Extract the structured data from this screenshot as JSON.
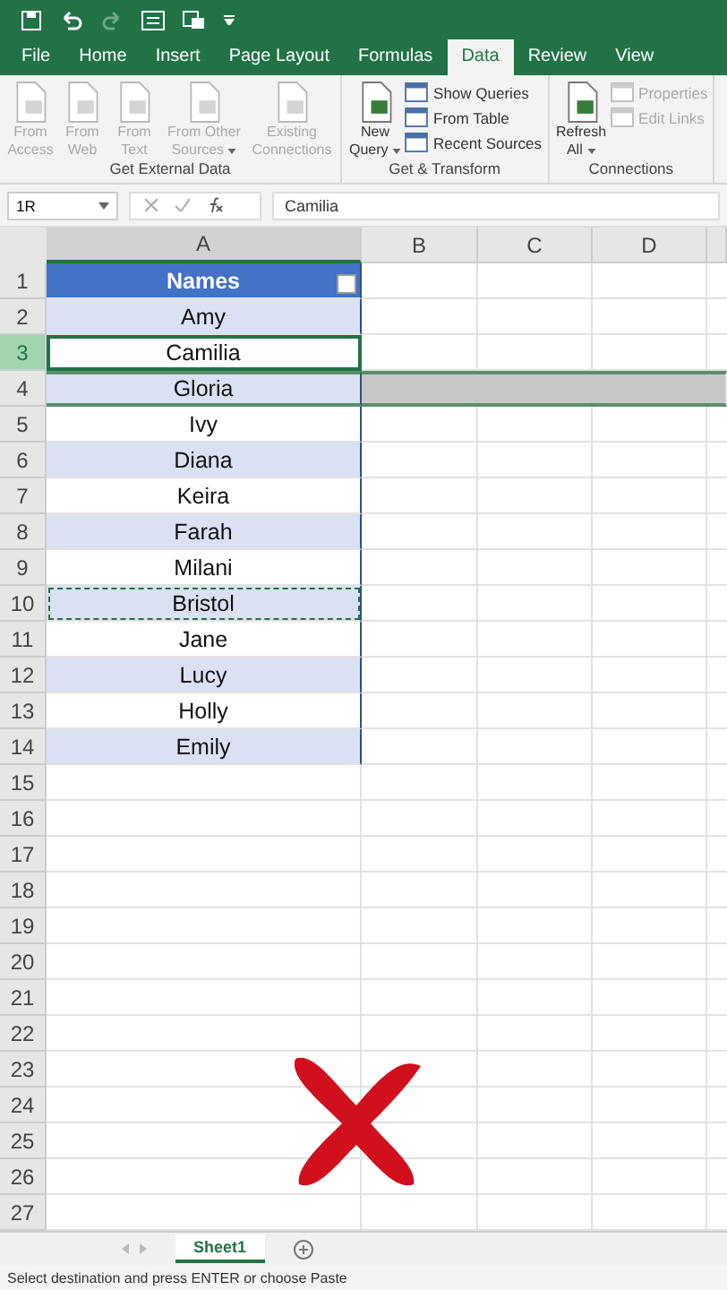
{
  "menu_tabs": [
    {
      "label": "File",
      "selected": false
    },
    {
      "label": "Home",
      "selected": false
    },
    {
      "label": "Insert",
      "selected": false
    },
    {
      "label": "Page Layout",
      "selected": false
    },
    {
      "label": "Formulas",
      "selected": false
    },
    {
      "label": "Data",
      "selected": true
    },
    {
      "label": "Review",
      "selected": false
    },
    {
      "label": "View",
      "selected": false
    }
  ],
  "ribbon_groups": [
    {
      "title": "Get External Data",
      "buttons": [
        {
          "kind": "large",
          "label": "From Access",
          "disabled": true,
          "dropdown": false
        },
        {
          "kind": "large",
          "label": "From Web",
          "disabled": true,
          "dropdown": false
        },
        {
          "kind": "large",
          "label": "From Text",
          "disabled": true,
          "dropdown": false
        },
        {
          "kind": "large",
          "label": "From Other Sources",
          "disabled": true,
          "dropdown": true
        },
        {
          "kind": "large",
          "label": "Existing Connections",
          "disabled": true,
          "dropdown": false
        }
      ]
    },
    {
      "title": "Get & Transform",
      "buttons": [
        {
          "kind": "large",
          "label": "New Query",
          "disabled": false,
          "dropdown": true
        },
        {
          "kind": "small",
          "label": "Show Queries",
          "disabled": false
        },
        {
          "kind": "small",
          "label": "From Table",
          "disabled": false
        },
        {
          "kind": "small",
          "label": "Recent Sources",
          "disabled": false
        }
      ]
    },
    {
      "title": "Connections",
      "buttons": [
        {
          "kind": "large",
          "label": "Refresh All",
          "disabled": false,
          "dropdown": true
        },
        {
          "kind": "small",
          "label": "Properties",
          "disabled": true
        },
        {
          "kind": "small",
          "label": "Edit Links",
          "disabled": true
        }
      ]
    }
  ],
  "name_box": "1R",
  "formula": "Camilia",
  "columns": [
    "A",
    "B",
    "C",
    "D"
  ],
  "header_cell": "Names",
  "rows": [
    {
      "name": "Amy",
      "selected": false,
      "copied": false,
      "drop_target": false
    },
    {
      "name": "Camilia",
      "selected": true,
      "copied": false,
      "drop_target": false
    },
    {
      "name": "Gloria",
      "selected": false,
      "copied": false,
      "drop_target": true
    },
    {
      "name": "Ivy",
      "selected": false,
      "copied": false,
      "drop_target": false
    },
    {
      "name": "Diana",
      "selected": false,
      "copied": false,
      "drop_target": false
    },
    {
      "name": "Keira",
      "selected": false,
      "copied": false,
      "drop_target": false
    },
    {
      "name": "Farah",
      "selected": false,
      "copied": false,
      "drop_target": false
    },
    {
      "name": "Milani",
      "selected": false,
      "copied": false,
      "drop_target": false
    },
    {
      "name": "Bristol",
      "selected": false,
      "copied": true,
      "drop_target": false
    },
    {
      "name": "Jane",
      "selected": false,
      "copied": false,
      "drop_target": false
    },
    {
      "name": "Lucy",
      "selected": false,
      "copied": false,
      "drop_target": false
    },
    {
      "name": "Holly",
      "selected": false,
      "copied": false,
      "drop_target": false
    },
    {
      "name": "Emily",
      "selected": false,
      "copied": false,
      "drop_target": false
    }
  ],
  "row_numbers": [
    "1",
    "2",
    "3",
    "4",
    "5",
    "6",
    "7",
    "8",
    "9",
    "10",
    "11",
    "12",
    "13",
    "14",
    "15",
    "16",
    "17",
    "18",
    "19",
    "20",
    "21",
    "22",
    "23",
    "24",
    "25",
    "26",
    "27"
  ],
  "sheet_tabs": [
    {
      "label": "Sheet1",
      "selected": true
    }
  ],
  "status_bar": "Select destination and press ENTER or choose Paste"
}
